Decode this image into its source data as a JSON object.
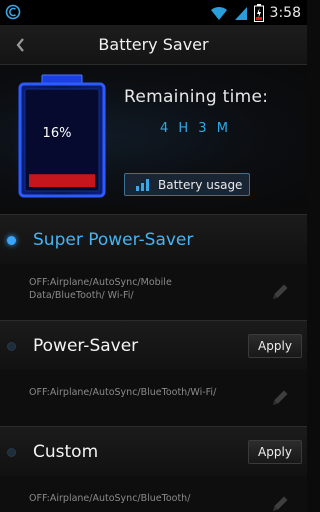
{
  "status_bar": {
    "time": "3:58",
    "icons": [
      "app-icon",
      "wifi-icon",
      "signal-icon",
      "battery-icon"
    ]
  },
  "header": {
    "title": "Battery Saver",
    "back_icon": "chevron-left-icon"
  },
  "battery": {
    "percent_label": "16%",
    "level": 0.16,
    "remaining_label": "Remaining time:",
    "remaining_value": "4 H 3 M"
  },
  "usage_button": {
    "label": "Battery usage",
    "icon": "bar-chart-icon"
  },
  "colors": {
    "accent": "#39a6ff",
    "battery_fill": "#c4161c",
    "background": "#0b0b0b"
  },
  "modes": [
    {
      "name": "Super Power-Saver",
      "description": "OFF:Airplane/AutoSync/Mobile Data/BlueTooth/ Wi-Fi/",
      "active": true
    },
    {
      "name": "Power-Saver",
      "description": "OFF:Airplane/AutoSync/BlueTooth/Wi-Fi/",
      "apply_label": "Apply",
      "active": false
    },
    {
      "name": "Custom",
      "description": "OFF:Airplane/AutoSync/BlueTooth/",
      "apply_label": "Apply",
      "active": false
    }
  ]
}
